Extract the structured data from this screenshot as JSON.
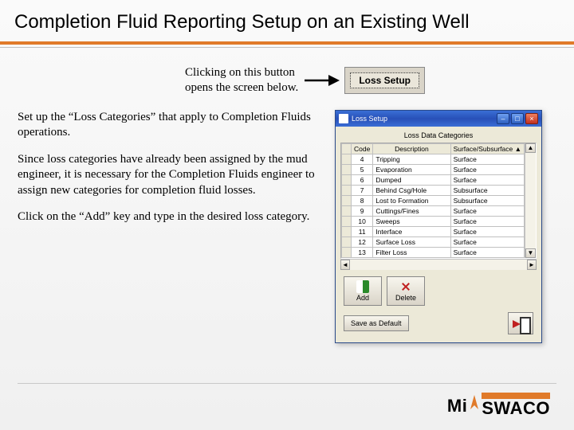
{
  "title": "Completion Fluid Reporting Setup on an Existing Well",
  "arrow_caption_l1": "Clicking on this button",
  "arrow_caption_l2": "opens the screen below.",
  "loss_setup_btn": "Loss Setup",
  "paragraphs": {
    "p1": "Set up the “Loss Categories” that apply to Completion Fluids operations.",
    "p2": "Since loss categories have already been assigned by the mud engineer, it is necessary for the Completion Fluids engineer to assign new categories for completion fluid losses.",
    "p3": "Click on the “Add” key and type in the desired loss category."
  },
  "window": {
    "title": "Loss Setup",
    "caption": "Loss Data Categories",
    "headers": {
      "code": "Code",
      "desc": "Description",
      "surf": "Surface/Subsurface"
    },
    "rows": [
      {
        "code": "4",
        "desc": "Tripping",
        "surf": "Surface"
      },
      {
        "code": "5",
        "desc": "Evaporation",
        "surf": "Surface"
      },
      {
        "code": "6",
        "desc": "Dumped",
        "surf": "Surface"
      },
      {
        "code": "7",
        "desc": "Behind Csg/Hole",
        "surf": "Subsurface"
      },
      {
        "code": "8",
        "desc": "Lost to Formation",
        "surf": "Subsurface"
      },
      {
        "code": "9",
        "desc": "Cuttings/Fines",
        "surf": "Surface"
      },
      {
        "code": "10",
        "desc": "Sweeps",
        "surf": "Surface"
      },
      {
        "code": "11",
        "desc": "Interface",
        "surf": "Surface"
      },
      {
        "code": "12",
        "desc": "Surface Loss",
        "surf": "Surface"
      },
      {
        "code": "13",
        "desc": "Filter Loss",
        "surf": "Surface"
      }
    ],
    "btn_add": "Add",
    "btn_delete": "Delete",
    "btn_default": "Save as Default"
  },
  "logo": {
    "mi": "Mi",
    "swaco": "SWACO"
  }
}
